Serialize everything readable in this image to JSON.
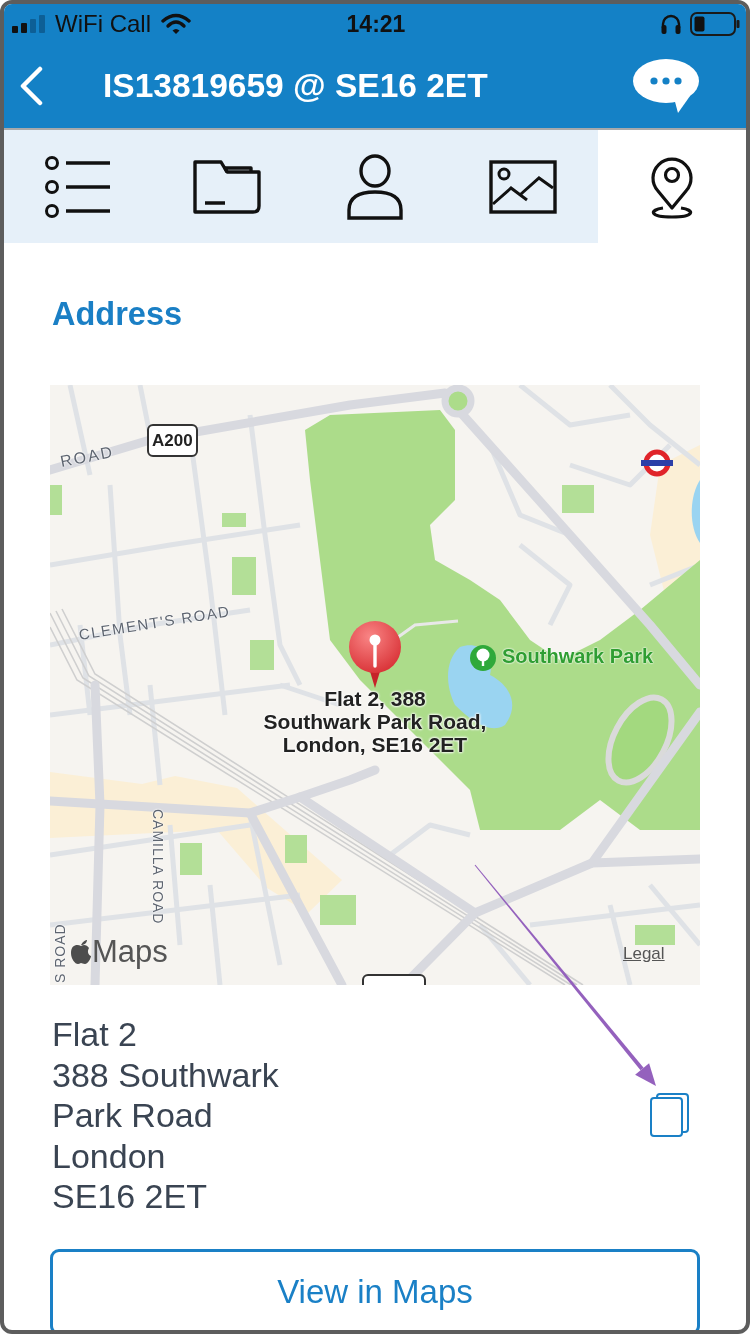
{
  "status_bar": {
    "carrier": "WiFi Call",
    "time": "14:21"
  },
  "nav_bar": {
    "title": "IS13819659 @ SE16 2ET"
  },
  "tabs": [
    {
      "kind": "list",
      "selected": false
    },
    {
      "kind": "folder",
      "selected": false
    },
    {
      "kind": "person",
      "selected": false
    },
    {
      "kind": "image",
      "selected": false
    },
    {
      "kind": "location",
      "selected": true
    }
  ],
  "address_section": {
    "heading": "Address",
    "map": {
      "road_shield": "A200",
      "road_labels": [
        "ROAD",
        "CLEMENT'S ROAD",
        "CAMILLA ROAD",
        "S ROAD"
      ],
      "place": "Southwark Park",
      "pin_label": [
        "Flat 2, 388",
        "Southwark Park Road,",
        "London, SE16 2ET"
      ],
      "logo": "Maps",
      "legal": "Legal"
    },
    "address_lines": [
      "Flat 2",
      "388 Southwark",
      "Park Road",
      "London",
      "SE16 2ET"
    ],
    "button": "View in Maps"
  },
  "annotations": [
    {
      "kind": "arrow"
    }
  ]
}
